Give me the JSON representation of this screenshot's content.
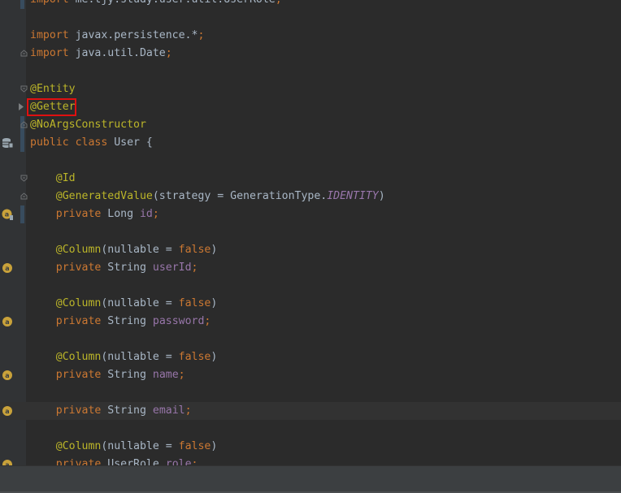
{
  "code_lines": [
    {
      "tokens": [
        {
          "t": "import",
          "c": "kw"
        },
        {
          "t": " me.tjy.study.user.util.UserRole",
          "c": "plain"
        },
        {
          "t": ";",
          "c": "punct"
        }
      ]
    },
    {
      "tokens": []
    },
    {
      "tokens": [
        {
          "t": "import",
          "c": "kw"
        },
        {
          "t": " javax.persistence.*",
          "c": "plain"
        },
        {
          "t": ";",
          "c": "punct"
        }
      ]
    },
    {
      "tokens": [
        {
          "t": "import",
          "c": "kw"
        },
        {
          "t": " java.util.Date",
          "c": "plain"
        },
        {
          "t": ";",
          "c": "punct"
        }
      ]
    },
    {
      "tokens": []
    },
    {
      "tokens": [
        {
          "t": "@Entity",
          "c": "ann"
        }
      ]
    },
    {
      "tokens": [
        {
          "t": "@Getter",
          "c": "ann"
        }
      ]
    },
    {
      "tokens": [
        {
          "t": "@NoArgsConstructor",
          "c": "ann"
        }
      ]
    },
    {
      "tokens": [
        {
          "t": "public",
          "c": "kw"
        },
        {
          "t": " ",
          "c": "plain"
        },
        {
          "t": "class",
          "c": "kw"
        },
        {
          "t": " User {",
          "c": "plain"
        }
      ]
    },
    {
      "tokens": []
    },
    {
      "tokens": [
        {
          "t": "    ",
          "c": "plain"
        },
        {
          "t": "@Id",
          "c": "ann"
        }
      ]
    },
    {
      "tokens": [
        {
          "t": "    ",
          "c": "plain"
        },
        {
          "t": "@GeneratedValue",
          "c": "ann"
        },
        {
          "t": "(strategy = GenerationType.",
          "c": "plain"
        },
        {
          "t": "IDENTITY",
          "c": "italic-field"
        },
        {
          "t": ")",
          "c": "plain"
        }
      ]
    },
    {
      "tokens": [
        {
          "t": "    ",
          "c": "plain"
        },
        {
          "t": "private",
          "c": "kw"
        },
        {
          "t": " Long ",
          "c": "plain"
        },
        {
          "t": "id",
          "c": "field"
        },
        {
          "t": ";",
          "c": "punct"
        }
      ]
    },
    {
      "tokens": []
    },
    {
      "tokens": [
        {
          "t": "    ",
          "c": "plain"
        },
        {
          "t": "@Column",
          "c": "ann"
        },
        {
          "t": "(nullable = ",
          "c": "plain"
        },
        {
          "t": "false",
          "c": "kw"
        },
        {
          "t": ")",
          "c": "plain"
        }
      ]
    },
    {
      "tokens": [
        {
          "t": "    ",
          "c": "plain"
        },
        {
          "t": "private",
          "c": "kw"
        },
        {
          "t": " String ",
          "c": "plain"
        },
        {
          "t": "userId",
          "c": "field"
        },
        {
          "t": ";",
          "c": "punct"
        }
      ]
    },
    {
      "tokens": []
    },
    {
      "tokens": [
        {
          "t": "    ",
          "c": "plain"
        },
        {
          "t": "@Column",
          "c": "ann"
        },
        {
          "t": "(nullable = ",
          "c": "plain"
        },
        {
          "t": "false",
          "c": "kw"
        },
        {
          "t": ")",
          "c": "plain"
        }
      ]
    },
    {
      "tokens": [
        {
          "t": "    ",
          "c": "plain"
        },
        {
          "t": "private",
          "c": "kw"
        },
        {
          "t": " String ",
          "c": "plain"
        },
        {
          "t": "password",
          "c": "field"
        },
        {
          "t": ";",
          "c": "punct"
        }
      ]
    },
    {
      "tokens": []
    },
    {
      "tokens": [
        {
          "t": "    ",
          "c": "plain"
        },
        {
          "t": "@Column",
          "c": "ann"
        },
        {
          "t": "(nullable = ",
          "c": "plain"
        },
        {
          "t": "false",
          "c": "kw"
        },
        {
          "t": ")",
          "c": "plain"
        }
      ]
    },
    {
      "tokens": [
        {
          "t": "    ",
          "c": "plain"
        },
        {
          "t": "private",
          "c": "kw"
        },
        {
          "t": " String ",
          "c": "plain"
        },
        {
          "t": "name",
          "c": "field"
        },
        {
          "t": ";",
          "c": "punct"
        }
      ]
    },
    {
      "tokens": []
    },
    {
      "tokens": [
        {
          "t": "    ",
          "c": "plain"
        },
        {
          "t": "private",
          "c": "kw"
        },
        {
          "t": " String ",
          "c": "plain"
        },
        {
          "t": "email",
          "c": "field"
        },
        {
          "t": ";",
          "c": "punct"
        }
      ],
      "current": true
    },
    {
      "tokens": []
    },
    {
      "tokens": [
        {
          "t": "    ",
          "c": "plain"
        },
        {
          "t": "@Column",
          "c": "ann"
        },
        {
          "t": "(nullable = ",
          "c": "plain"
        },
        {
          "t": "false",
          "c": "kw"
        },
        {
          "t": ")",
          "c": "plain"
        }
      ]
    },
    {
      "tokens": [
        {
          "t": "    ",
          "c": "plain"
        },
        {
          "t": "private",
          "c": "kw"
        },
        {
          "t": " UserRole ",
          "c": "plain"
        },
        {
          "t": "role",
          "c": "field"
        },
        {
          "t": ";",
          "c": "punct"
        }
      ]
    }
  ],
  "highlighted_annotation": "@Getter",
  "gutter_icons": [
    {
      "line": 8,
      "icon": "database-table-icon"
    },
    {
      "line": 12,
      "icon": "primary-key-column-icon"
    },
    {
      "line": 15,
      "icon": "column-icon"
    },
    {
      "line": 18,
      "icon": "column-icon"
    },
    {
      "line": 21,
      "icon": "column-icon"
    },
    {
      "line": 23,
      "icon": "column-icon"
    },
    {
      "line": 26,
      "icon": "column-icon"
    }
  ],
  "colors": {
    "background": "#2b2b2b",
    "keyword": "#cc7832",
    "annotation": "#bbb529",
    "field": "#9876aa",
    "text": "#a9b7c6",
    "highlight_box": "#e01010"
  }
}
